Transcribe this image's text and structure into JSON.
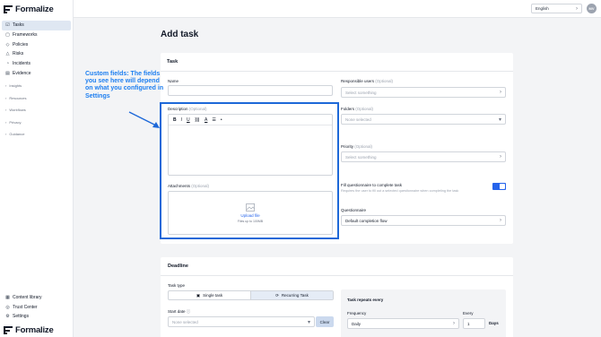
{
  "app": {
    "name": "Formalize"
  },
  "sidebar": {
    "items": [
      {
        "label": "Tasks",
        "icon": "tasks-icon",
        "active": true
      },
      {
        "label": "Frameworks",
        "icon": "frameworks-icon"
      },
      {
        "label": "Policies",
        "icon": "policies-icon"
      },
      {
        "label": "Risks",
        "icon": "risks-icon"
      },
      {
        "label": "Incidents",
        "icon": "incidents-icon"
      },
      {
        "label": "Evidence",
        "icon": "evidence-icon"
      }
    ],
    "groups": [
      "Insights",
      "Resources",
      "Workflows",
      "Privacy",
      "Guidance"
    ],
    "bottom_items": [
      {
        "label": "Content library",
        "icon": "library-icon"
      },
      {
        "label": "Trust Center",
        "icon": "trust-icon"
      },
      {
        "label": "Settings",
        "icon": "settings-icon"
      }
    ]
  },
  "topbar": {
    "language": "English",
    "avatar_initials": "MV"
  },
  "page": {
    "title": "Add task"
  },
  "task_card": {
    "title": "Task",
    "name_label": "Name",
    "description_label": "Description",
    "optional": "(Optional)",
    "attachments_label": "Attachments",
    "upload_link": "Upload file",
    "upload_hint": "Files up to 100MB",
    "responsible_label": "Responsible users",
    "responsible_placeholder": "Select something",
    "folders_label": "Folders",
    "folders_placeholder": "None selected",
    "priority_label": "Priority",
    "priority_placeholder": "Select something",
    "questionnaire_toggle_label": "Fill questionnaire to complete task",
    "questionnaire_toggle_helper": "Requires the user to fill out a selected questionnaire when completing the task",
    "questionnaire_label": "Questionnaire",
    "questionnaire_value": "Default completion flow",
    "toolbar": [
      "B",
      "I",
      "U",
      "⛓",
      "A",
      "☰",
      "•"
    ]
  },
  "callout": {
    "text": "Custom fields: The fields you see here will depend on what you configured in Settings"
  },
  "deadline_card": {
    "title": "Deadline",
    "task_type_label": "Task type",
    "single_label": "Single task",
    "recurring_label": "Recurring Task",
    "start_date_label": "Start date",
    "start_date_placeholder": "None selected",
    "clear_label": "Clear",
    "repeats_label": "Task repeats every",
    "frequency_label": "Frequency",
    "frequency_value": "Daily",
    "every_label": "Every",
    "every_value": "1",
    "every_unit": "Days"
  },
  "colors": {
    "accent": "#2563eb",
    "callout": "#1e7ff0",
    "highlight": "#1d68d8"
  }
}
